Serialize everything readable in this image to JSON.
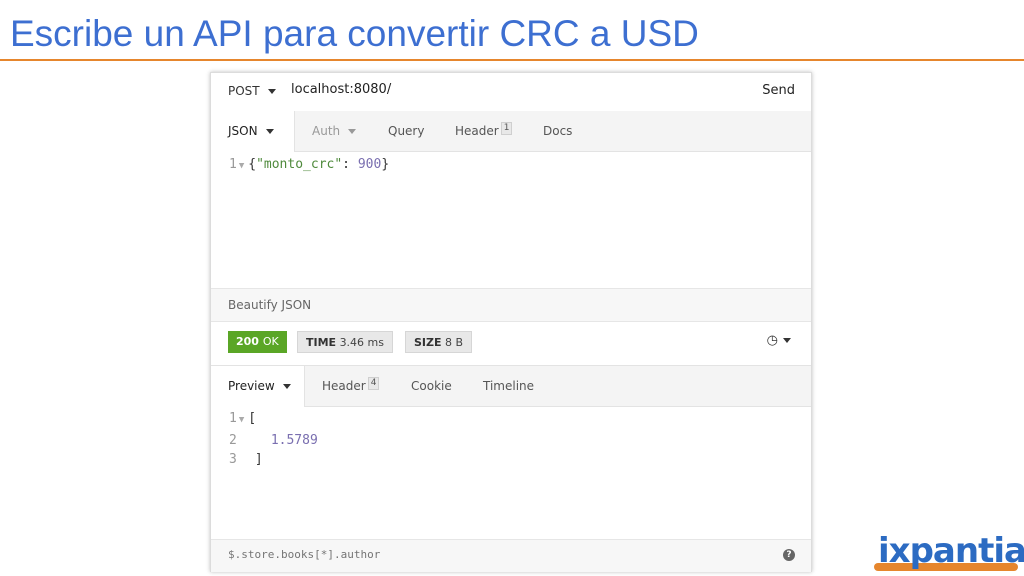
{
  "slide": {
    "title": "Escribe un API para convertir CRC a USD",
    "accent_color": "#3d6fd1",
    "rule_color": "#e6862d"
  },
  "request": {
    "method": "POST",
    "url": "localhost:8080/",
    "send_label": "Send",
    "tabs": {
      "body": "JSON",
      "auth": "Auth",
      "query": "Query",
      "header": "Header",
      "header_count": "1",
      "docs": "Docs"
    },
    "body": {
      "line": "1",
      "open": "{",
      "key": "\"monto_crc\"",
      "colon": ": ",
      "value": "900",
      "close": "}"
    },
    "beautify_label": "Beautify JSON"
  },
  "response": {
    "status": {
      "code": "200",
      "text": "OK",
      "color": "#5aa626"
    },
    "time": {
      "label": "TIME",
      "value": "3.46 ms"
    },
    "size": {
      "label": "SIZE",
      "value": "8 B"
    },
    "tabs": {
      "preview": "Preview",
      "header": "Header",
      "header_count": "4",
      "cookie": "Cookie",
      "timeline": "Timeline"
    },
    "body": [
      {
        "line": "1",
        "text": "["
      },
      {
        "line": "2",
        "text": "1.5789"
      },
      {
        "line": "3",
        "text": "]"
      }
    ],
    "filter_placeholder": "$.store.books[*].author"
  },
  "logo": {
    "text": "ixpantia"
  }
}
